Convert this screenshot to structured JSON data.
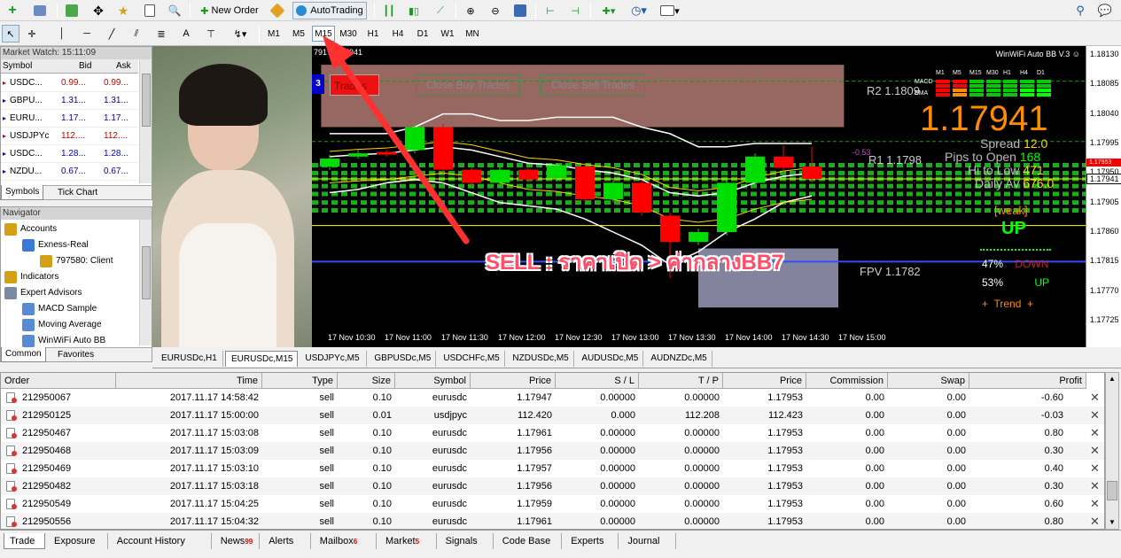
{
  "toolbar": {
    "new_order": "New Order",
    "autotrading": "AutoTrading"
  },
  "timeframes": [
    "M1",
    "M5",
    "M15",
    "M30",
    "H1",
    "H4",
    "D1",
    "W1",
    "MN"
  ],
  "active_timeframe": "M15",
  "market_watch": {
    "title": "Market Watch: 15:11:09",
    "col_symbol": "Symbol",
    "col_bid": "Bid",
    "col_ask": "Ask",
    "rows": [
      {
        "symbol": "USDC...",
        "bid": "0.99...",
        "ask": "0.99...",
        "color": "#cc0000"
      },
      {
        "symbol": "GBPU...",
        "bid": "1.31...",
        "ask": "1.31...",
        "color": "#0000cc"
      },
      {
        "symbol": "EURU...",
        "bid": "1.17...",
        "ask": "1.17...",
        "color": "#0000cc"
      },
      {
        "symbol": "USDJPYc",
        "bid": "112....",
        "ask": "112....",
        "color": "#cc0000"
      },
      {
        "symbol": "USDC...",
        "bid": "1.28...",
        "ask": "1.28...",
        "color": "#0000cc"
      },
      {
        "symbol": "NZDU...",
        "bid": "0.67...",
        "ask": "0.67...",
        "color": "#0000cc"
      }
    ],
    "tab_symbols": "Symbols",
    "tab_tick": "Tick Chart"
  },
  "navigator": {
    "title": "Navigator",
    "items": [
      "Accounts",
      "Exness-Real",
      "797580: Client",
      "Indicators",
      "Expert Advisors",
      "MACD Sample",
      "Moving Average",
      "WinWiFi Auto BB"
    ],
    "tab_common": "Common",
    "tab_favorites": "Favorites"
  },
  "chart": {
    "header_text": "7917  1.17941",
    "ea_name": "WinWiFi Auto BB V.3",
    "btn_left_small": "3",
    "btn_trade": "Trades",
    "btn_close_buy": "Close Buy Trades",
    "btn_close_sell": "Close Sell Trades",
    "r2": "R2  1.1809",
    "r1": "R1  1.1798",
    "fpv": "FPV  1.1782",
    "big_price": "1.17941",
    "spread_label": "Spread",
    "spread_val": "12.0",
    "pips_label": "Pips to Open",
    "pips_val": "168",
    "hilo_label": "Hi to Low",
    "hilo_val": "471",
    "daily_label": "Daily Av",
    "daily_val": "676.0",
    "minus_val": "-0.53",
    "weak": "[weak]",
    "direction": "UP",
    "pct_down": "47%",
    "down_label": "DOWN",
    "pct_up": "53%",
    "up_label": "UP",
    "trend": "+  Trend  +",
    "mtf_headers": [
      "M1",
      "M5",
      "M15",
      "M30",
      "H1",
      "H4",
      "D1"
    ],
    "macd_label": "MACD",
    "emas_label": "EMA",
    "annotation": "SELL : ราคาเปิด > ค่ากลางBB7",
    "price_labels": [
      "1.18130",
      "1.18085",
      "1.18040",
      "1.17995",
      "1.17950",
      "1.17905",
      "1.17860",
      "1.17815",
      "1.17770",
      "1.17725"
    ],
    "current_price_tag": "1.17941",
    "red_price_tag": "1.17953",
    "time_labels": [
      "17 Nov 10:30",
      "17 Nov 11:00",
      "17 Nov 11:30",
      "17 Nov 12:00",
      "17 Nov 12:30",
      "17 Nov 13:00",
      "17 Nov 13:30",
      "17 Nov 14:00",
      "17 Nov 14:30",
      "17 Nov 15:00"
    ],
    "candles": [
      {
        "o": 1.1796,
        "c": 1.17972,
        "h": 1.17978,
        "l": 1.17955
      },
      {
        "o": 1.17975,
        "c": 1.1798,
        "h": 1.17985,
        "l": 1.17972
      },
      {
        "o": 1.17982,
        "c": 1.17978,
        "h": 1.17985,
        "l": 1.17975
      },
      {
        "o": 1.17985,
        "c": 1.1802,
        "h": 1.18025,
        "l": 1.1798
      },
      {
        "o": 1.1802,
        "c": 1.17955,
        "h": 1.18025,
        "l": 1.1795
      },
      {
        "o": 1.17955,
        "c": 1.17935,
        "h": 1.17958,
        "l": 1.1793
      },
      {
        "o": 1.17935,
        "c": 1.17955,
        "h": 1.1796,
        "l": 1.1793
      },
      {
        "o": 1.17955,
        "c": 1.1794,
        "h": 1.17958,
        "l": 1.17935
      },
      {
        "o": 1.17942,
        "c": 1.17962,
        "h": 1.17965,
        "l": 1.17938
      },
      {
        "o": 1.1796,
        "c": 1.1791,
        "h": 1.17965,
        "l": 1.17905
      },
      {
        "o": 1.1791,
        "c": 1.17935,
        "h": 1.1794,
        "l": 1.17905
      },
      {
        "o": 1.17935,
        "c": 1.1789,
        "h": 1.1794,
        "l": 1.17885
      },
      {
        "o": 1.17885,
        "c": 1.17845,
        "h": 1.1789,
        "l": 1.1779
      },
      {
        "o": 1.17845,
        "c": 1.1786,
        "h": 1.17865,
        "l": 1.1784
      },
      {
        "o": 1.1786,
        "c": 1.17935,
        "h": 1.1794,
        "l": 1.17855
      },
      {
        "o": 1.17935,
        "c": 1.17975,
        "h": 1.1798,
        "l": 1.1793
      },
      {
        "o": 1.17975,
        "c": 1.17958,
        "h": 1.17992,
        "l": 1.17952
      },
      {
        "o": 1.1796,
        "c": 1.17941,
        "h": 1.1799,
        "l": 1.17935
      }
    ],
    "bb_upper": [
      1.1801,
      1.1801,
      1.1801,
      1.1802,
      1.1804,
      1.1804,
      1.1803,
      1.1803,
      1.18035,
      1.18035,
      1.18035,
      1.1802,
      1.1801,
      1.1799,
      1.1799,
      1.17995,
      1.17995,
      1.17995
    ],
    "bb_mid": [
      1.17975,
      1.17978,
      1.1798,
      1.17985,
      1.1799,
      1.17985,
      1.17975,
      1.17965,
      1.17962,
      1.17955,
      1.1795,
      1.1794,
      1.1792,
      1.17915,
      1.1792,
      1.17935,
      1.17945,
      1.1795
    ],
    "bb_lower": [
      1.1792,
      1.17925,
      1.17935,
      1.1794,
      1.17935,
      1.1792,
      1.17905,
      1.179,
      1.17895,
      1.1788,
      1.1786,
      1.1784,
      1.1781,
      1.1783,
      1.1786,
      1.1788,
      1.17905,
      1.17915
    ],
    "y_min": 1.17725,
    "y_max": 1.1813
  },
  "chart_tabs": [
    "EURUSDc,H1",
    "EURUSDc,M15",
    "USDJPYc,M5",
    "GBPUSDc,M5",
    "USDCHFc,M5",
    "NZDUSDc,M5",
    "AUDUSDc,M5",
    "AUDNZDc,M5"
  ],
  "active_chart_tab": "EURUSDc,M15",
  "orders": {
    "headers": [
      "Order",
      "Time",
      "Type",
      "Size",
      "Symbol",
      "Price",
      "S / L",
      "T / P",
      "Price",
      "Commission",
      "Swap",
      "Profit"
    ],
    "rows": [
      [
        "212950067",
        "2017.11.17 14:58:42",
        "sell",
        "0.10",
        "eurusdc",
        "1.17947",
        "0.00000",
        "0.00000",
        "1.17953",
        "0.00",
        "0.00",
        "-0.60"
      ],
      [
        "212950125",
        "2017.11.17 15:00:00",
        "sell",
        "0.01",
        "usdjpyc",
        "112.420",
        "0.000",
        "112.208",
        "112.423",
        "0.00",
        "0.00",
        "-0.03"
      ],
      [
        "212950467",
        "2017.11.17 15:03:08",
        "sell",
        "0.10",
        "eurusdc",
        "1.17961",
        "0.00000",
        "0.00000",
        "1.17953",
        "0.00",
        "0.00",
        "0.80"
      ],
      [
        "212950468",
        "2017.11.17 15:03:09",
        "sell",
        "0.10",
        "eurusdc",
        "1.17956",
        "0.00000",
        "0.00000",
        "1.17953",
        "0.00",
        "0.00",
        "0.30"
      ],
      [
        "212950469",
        "2017.11.17 15:03:10",
        "sell",
        "0.10",
        "eurusdc",
        "1.17957",
        "0.00000",
        "0.00000",
        "1.17953",
        "0.00",
        "0.00",
        "0.40"
      ],
      [
        "212950482",
        "2017.11.17 15:03:18",
        "sell",
        "0.10",
        "eurusdc",
        "1.17956",
        "0.00000",
        "0.00000",
        "1.17953",
        "0.00",
        "0.00",
        "0.30"
      ],
      [
        "212950549",
        "2017.11.17 15:04:25",
        "sell",
        "0.10",
        "eurusdc",
        "1.17959",
        "0.00000",
        "0.00000",
        "1.17953",
        "0.00",
        "0.00",
        "0.60"
      ],
      [
        "212950556",
        "2017.11.17 15:04:32",
        "sell",
        "0.10",
        "eurusdc",
        "1.17961",
        "0.00000",
        "0.00000",
        "1.17953",
        "0.00",
        "0.00",
        "0.80"
      ]
    ]
  },
  "bottom_tabs": [
    {
      "label": "Trade",
      "count": ""
    },
    {
      "label": "Exposure",
      "count": ""
    },
    {
      "label": "Account History",
      "count": ""
    },
    {
      "label": "News",
      "count": "99"
    },
    {
      "label": "Alerts",
      "count": ""
    },
    {
      "label": "Mailbox",
      "count": "6"
    },
    {
      "label": "Market",
      "count": "5"
    },
    {
      "label": "Signals",
      "count": ""
    },
    {
      "label": "Code Base",
      "count": ""
    },
    {
      "label": "Experts",
      "count": ""
    },
    {
      "label": "Journal",
      "count": ""
    }
  ],
  "active_bottom_tab": "Trade",
  "colors": {
    "bull": "#00dd00",
    "bear": "#ff0000",
    "accent": "#ff8c00",
    "up": "#00ff00"
  }
}
